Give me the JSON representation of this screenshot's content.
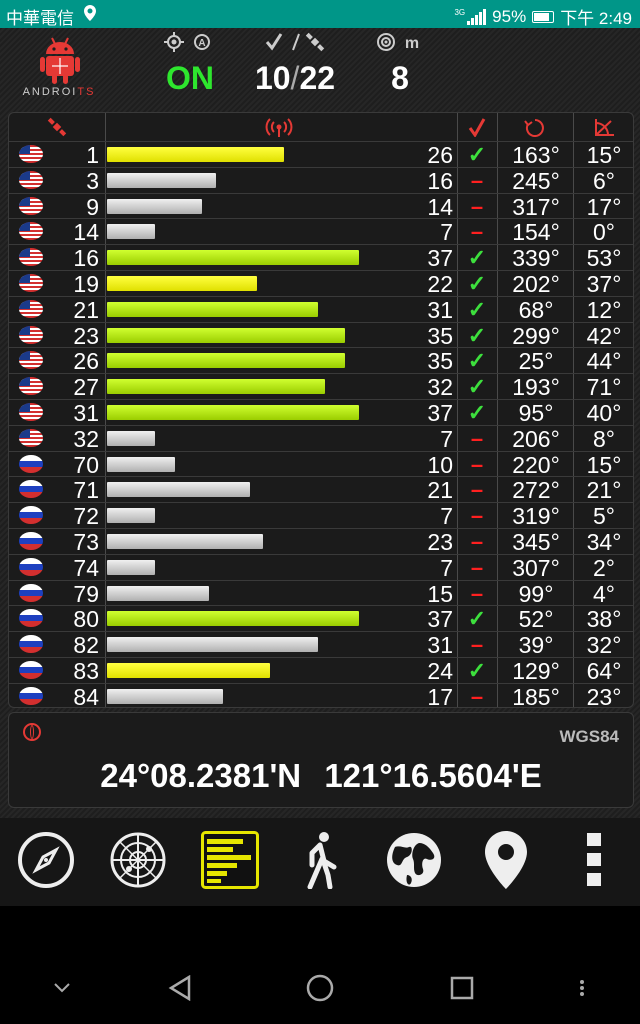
{
  "status_bar": {
    "carrier": "中華電信",
    "network": "3G",
    "battery": "95%",
    "time": "下午 2:49"
  },
  "header": {
    "brand_prefix": "ANDROI",
    "brand_suffix": "TS",
    "gps_status": "ON",
    "sats_used": "10",
    "sats_total": "22",
    "accuracy": "8",
    "accuracy_unit": "m",
    "gps_status_color": "#2ee62e"
  },
  "satellites": [
    {
      "flag": "us",
      "prn": "1",
      "snr": "26",
      "snr_value": 26,
      "used": true,
      "color": "yellow",
      "az": "163°",
      "el": "15°"
    },
    {
      "flag": "us",
      "prn": "3",
      "snr": "16",
      "snr_value": 16,
      "used": false,
      "color": "gray",
      "az": "245°",
      "el": "6°"
    },
    {
      "flag": "us",
      "prn": "9",
      "snr": "14",
      "snr_value": 14,
      "used": false,
      "color": "gray",
      "az": "317°",
      "el": "17°"
    },
    {
      "flag": "us",
      "prn": "14",
      "snr": "7",
      "snr_value": 7,
      "used": false,
      "color": "gray",
      "az": "154°",
      "el": "0°"
    },
    {
      "flag": "us",
      "prn": "16",
      "snr": "37",
      "snr_value": 37,
      "used": true,
      "color": "green",
      "az": "339°",
      "el": "53°"
    },
    {
      "flag": "us",
      "prn": "19",
      "snr": "22",
      "snr_value": 22,
      "used": true,
      "color": "yellow",
      "az": "202°",
      "el": "37°"
    },
    {
      "flag": "us",
      "prn": "21",
      "snr": "31",
      "snr_value": 31,
      "used": true,
      "color": "green",
      "az": "68°",
      "el": "12°"
    },
    {
      "flag": "us",
      "prn": "23",
      "snr": "35",
      "snr_value": 35,
      "used": true,
      "color": "green",
      "az": "299°",
      "el": "42°"
    },
    {
      "flag": "us",
      "prn": "26",
      "snr": "35",
      "snr_value": 35,
      "used": true,
      "color": "green",
      "az": "25°",
      "el": "44°"
    },
    {
      "flag": "us",
      "prn": "27",
      "snr": "32",
      "snr_value": 32,
      "used": true,
      "color": "green",
      "az": "193°",
      "el": "71°"
    },
    {
      "flag": "us",
      "prn": "31",
      "snr": "37",
      "snr_value": 37,
      "used": true,
      "color": "green",
      "az": "95°",
      "el": "40°"
    },
    {
      "flag": "us",
      "prn": "32",
      "snr": "7",
      "snr_value": 7,
      "used": false,
      "color": "gray",
      "az": "206°",
      "el": "8°"
    },
    {
      "flag": "ru",
      "prn": "70",
      "snr": "10",
      "snr_value": 10,
      "used": false,
      "color": "gray",
      "az": "220°",
      "el": "15°"
    },
    {
      "flag": "ru",
      "prn": "71",
      "snr": "21",
      "snr_value": 21,
      "used": false,
      "color": "gray",
      "az": "272°",
      "el": "21°"
    },
    {
      "flag": "ru",
      "prn": "72",
      "snr": "7",
      "snr_value": 7,
      "used": false,
      "color": "gray",
      "az": "319°",
      "el": "5°"
    },
    {
      "flag": "ru",
      "prn": "73",
      "snr": "23",
      "snr_value": 23,
      "used": false,
      "color": "gray",
      "az": "345°",
      "el": "34°"
    },
    {
      "flag": "ru",
      "prn": "74",
      "snr": "7",
      "snr_value": 7,
      "used": false,
      "color": "gray",
      "az": "307°",
      "el": "2°"
    },
    {
      "flag": "ru",
      "prn": "79",
      "snr": "15",
      "snr_value": 15,
      "used": false,
      "color": "gray",
      "az": "99°",
      "el": "4°"
    },
    {
      "flag": "ru",
      "prn": "80",
      "snr": "37",
      "snr_value": 37,
      "used": true,
      "color": "green",
      "az": "52°",
      "el": "38°"
    },
    {
      "flag": "ru",
      "prn": "82",
      "snr": "31",
      "snr_value": 31,
      "used": false,
      "color": "gray",
      "az": "39°",
      "el": "32°"
    },
    {
      "flag": "ru",
      "prn": "83",
      "snr": "24",
      "snr_value": 24,
      "used": true,
      "color": "yellow",
      "az": "129°",
      "el": "64°"
    },
    {
      "flag": "ru",
      "prn": "84",
      "snr": "17",
      "snr_value": 17,
      "used": false,
      "color": "gray",
      "az": "185°",
      "el": "23°"
    }
  ],
  "coordinates": {
    "datum": "WGS84",
    "latitude": "24°08.2381'N",
    "longitude": "121°16.5604'E"
  },
  "toolbar": {
    "items": [
      "compass-icon",
      "radar-icon",
      "signal-bars-icon",
      "walking-icon",
      "globe-icon",
      "map-pin-icon",
      "more-icon"
    ],
    "active": "signal-bars-icon"
  },
  "colors": {
    "accent_red": "#e53935",
    "used_check": "#3de03d",
    "status_bar": "#009688"
  }
}
